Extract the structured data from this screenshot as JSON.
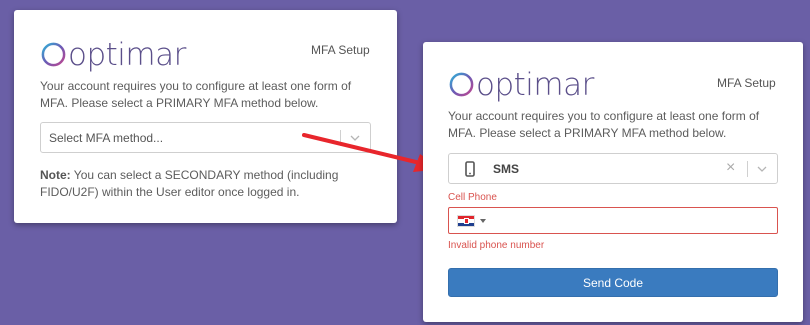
{
  "colors": {
    "background": "#6a5fa6",
    "brand": "#5b4f8a",
    "error": "#d9534f",
    "primary_button": "#3a7bbf",
    "arrow": "#e8262c"
  },
  "left_card": {
    "logo_text": "optimar",
    "title": "MFA Setup",
    "description": "Your account requires you to configure at least one form of MFA. Please select a PRIMARY MFA method below.",
    "select_placeholder": "Select MFA method...",
    "note_label": "Note:",
    "note_text": " You can select a SECONDARY method (including FIDO/U2F) within the User editor once logged in."
  },
  "right_card": {
    "logo_text": "optimar",
    "title": "MFA Setup",
    "description": "Your account requires you to configure at least one form of MFA. Please select a PRIMARY MFA method below.",
    "selected_method": "SMS",
    "selected_method_icon": "mobile-phone-icon",
    "clear_glyph": "×",
    "phone_label": "Cell Phone",
    "phone_value": "",
    "country_flag_icon": "croatia-flag-icon",
    "phone_error": "Invalid phone number",
    "send_button": "Send Code"
  }
}
